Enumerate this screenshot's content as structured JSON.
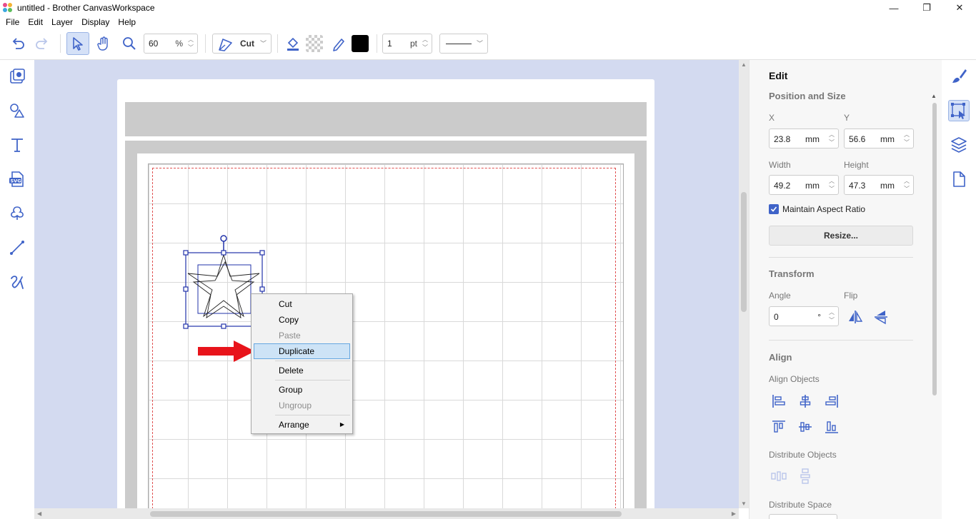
{
  "window": {
    "title": "untitled - Brother CanvasWorkspace",
    "minimize": "—",
    "restore": "❐",
    "close": "✕"
  },
  "menu": [
    "File",
    "Edit",
    "Layer",
    "Display",
    "Help"
  ],
  "toolbar": {
    "zoom_value": "60",
    "zoom_unit": "%",
    "mode_label": "Cut",
    "line_width_value": "1",
    "line_width_unit": "pt",
    "line_color": "#000000"
  },
  "left_tools": [
    "templates-icon",
    "shapes-icon",
    "text-icon",
    "svg-import-icon",
    "image-trace-icon",
    "line-tool-icon",
    "freehand-icon"
  ],
  "context_menu": {
    "items": [
      {
        "label": "Cut",
        "enabled": true
      },
      {
        "label": "Copy",
        "enabled": true
      },
      {
        "label": "Paste",
        "enabled": false
      },
      {
        "label": "Duplicate",
        "enabled": true,
        "highlighted": true
      },
      {
        "label": "Delete",
        "enabled": true
      },
      {
        "label": "Group",
        "enabled": true
      },
      {
        "label": "Ungroup",
        "enabled": false
      },
      {
        "label": "Arrange",
        "enabled": true,
        "submenu": true
      }
    ]
  },
  "edit_panel": {
    "title": "Edit",
    "position_size": {
      "heading": "Position and Size",
      "x_label": "X",
      "x_value": "23.8",
      "x_unit": "mm",
      "y_label": "Y",
      "y_value": "56.6",
      "y_unit": "mm",
      "width_label": "Width",
      "width_value": "49.2",
      "width_unit": "mm",
      "height_label": "Height",
      "height_value": "47.3",
      "height_unit": "mm",
      "aspect_label": "Maintain Aspect Ratio",
      "aspect_checked": true,
      "resize_label": "Resize..."
    },
    "transform": {
      "heading": "Transform",
      "angle_label": "Angle",
      "angle_value": "0",
      "angle_unit": "°",
      "flip_label": "Flip"
    },
    "align": {
      "heading": "Align",
      "align_objects_label": "Align Objects",
      "distribute_objects_label": "Distribute Objects",
      "distribute_space_label": "Distribute Space"
    }
  },
  "colors": {
    "accent": "#3f63c8",
    "canvas_bg": "#d3daf0",
    "highlight": "#cde3f6",
    "arrow_red": "#e8141b"
  }
}
